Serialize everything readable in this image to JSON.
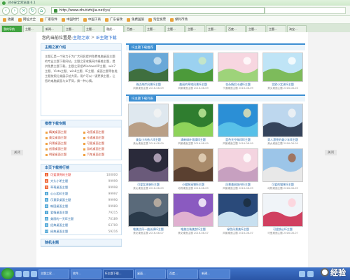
{
  "browser": {
    "title": "360安全浏览器 6.1",
    "url": "http://www.zhutizhijia.net/ys/",
    "bookmarks": [
      "收藏",
      "网址大全",
      "厂家软件",
      "中国时代",
      "中国工商",
      "广东省政",
      "免费国旅",
      "淘宝发票",
      "保利市场"
    ],
    "tabs": [
      "我的导航",
      "主题...",
      "新闻...",
      "主题...",
      "主题...",
      "雅虎...",
      "百度...",
      "主题...",
      "主题...",
      "主题...",
      "主题...",
      "百度...",
      "主题...",
      "主题...",
      "淘宝..."
    ],
    "sidebar_close": "关闭"
  },
  "breadcrumb": {
    "label": "您的当前位置是:",
    "home": "主题之家",
    "current": "IE主题下载"
  },
  "about": {
    "title": "主题之家介绍",
    "text": "主题汇是一个致力于为广大网民提供免费电脑桌面主题的专业主题下载网站。主题之家收集网内精美主题，提供免费主题下载。主题之家把WindowsXP主题、win7主题、Vista主题、win8主题、IE主题、桌面主题等各类主题按照分类展示给大家。用户可以一键更换主题，让您的电脑桌面与众不同，换一种心情。"
  },
  "links": {
    "title": "推荐下载专题",
    "items": [
      "精美桌面主题",
      "动感桌面主题",
      "美女桌面主题",
      "卡通桌面主题",
      "风景桌面主题",
      "可爱桌面主题",
      "创意桌面主题",
      "游戏桌面主题",
      "明星桌面主题",
      "汽车桌面主题"
    ]
  },
  "ranking": {
    "title": "本页下载排行榜",
    "items": [
      {
        "no": "1",
        "name": "可爱漂亮的主题",
        "count": "100000"
      },
      {
        "no": "2",
        "name": "大头小明主题",
        "count": "99999"
      },
      {
        "no": "3",
        "name": "草莓桌面主题",
        "count": "99998"
      },
      {
        "no": "4",
        "name": "心心相印主题",
        "count": "99997"
      },
      {
        "no": "5",
        "name": "乐意家桌面主题",
        "count": "99990"
      },
      {
        "no": "6",
        "name": "韩国桌面主题",
        "count": "99989"
      },
      {
        "no": "7",
        "name": "爱情桌面主题",
        "count": "79215"
      },
      {
        "no": "8",
        "name": "美丽的一天IE主题",
        "count": "70189"
      },
      {
        "no": "9",
        "name": "经典桌面主题",
        "count": "63700"
      },
      {
        "no": "10",
        "name": "经典桌面主题",
        "count": "59216"
      }
    ]
  },
  "bottom_box_title": "随机主题",
  "recommended": {
    "title": "IE主题下载推荐",
    "items": [
      {
        "title": "海边海岸风景IE主题",
        "type": "风景桌面主题",
        "date": "2016-08-09"
      },
      {
        "title": "美丽的草地风景IE主题",
        "type": "风景桌面主题",
        "date": "2016-08-09"
      },
      {
        "title": "花朵情侣卡通IE主题",
        "type": "卡通桌面主题",
        "date": "2016-08-09"
      },
      {
        "title": "北欧小女孩IE主题",
        "type": "美女桌面主题",
        "date": "2016-08-03"
      }
    ]
  },
  "list": {
    "title": "IE主题下载列表",
    "items": [
      {
        "title": "美女小鸟依人IE主题",
        "type": "美女桌面主题",
        "date": "2016-08-09"
      },
      {
        "title": "清新绿叶雨滴IE主题",
        "type": "风景桌面主题",
        "date": "2016-08-09"
      },
      {
        "title": "蓝色天空海岸IE主题",
        "type": "风景桌面主题",
        "date": "2016-08-09"
      },
      {
        "title": "男人漂亮的美少年IE主题",
        "type": "美女桌面主题",
        "date": "2016-08-09"
      },
      {
        "title": "可爱女孩装IE主题",
        "type": "美女桌面主题",
        "date": "2016-08-09"
      },
      {
        "title": "小猫狗宠物IE主题",
        "type": "动物桌面主题",
        "date": "2016-08-09"
      },
      {
        "title": "风景美丽城市IE主题",
        "type": "风景桌面主题",
        "date": "2016-08-09"
      },
      {
        "title": "可爱的猫咪IE主题",
        "type": "动物桌面主题",
        "date": "2016-08-09"
      },
      {
        "title": "唯美古风一曲长情IE主题",
        "type": "美女桌面主题",
        "date": "2016-08-07"
      },
      {
        "title": "唯美古装美女IE主题",
        "type": "美女桌面主题",
        "date": "2016-08-07"
      },
      {
        "title": "绿色风景美IE主题",
        "type": "风景桌面主题",
        "date": "2016-08-07"
      },
      {
        "title": "可爱桃心IE主题",
        "type": "可爱桌面主题",
        "date": "2016-08-07"
      }
    ]
  },
  "taskbar": {
    "tasks": [
      "主题之家...",
      "软件...",
      "IE主题下载...",
      "桌面...",
      "百度...",
      "新建..."
    ]
  },
  "watermark": "经验",
  "colors": {
    "accent": "#3d8fd2",
    "browser_green": "#3fa33f",
    "taskbar": "#2a55a6"
  }
}
